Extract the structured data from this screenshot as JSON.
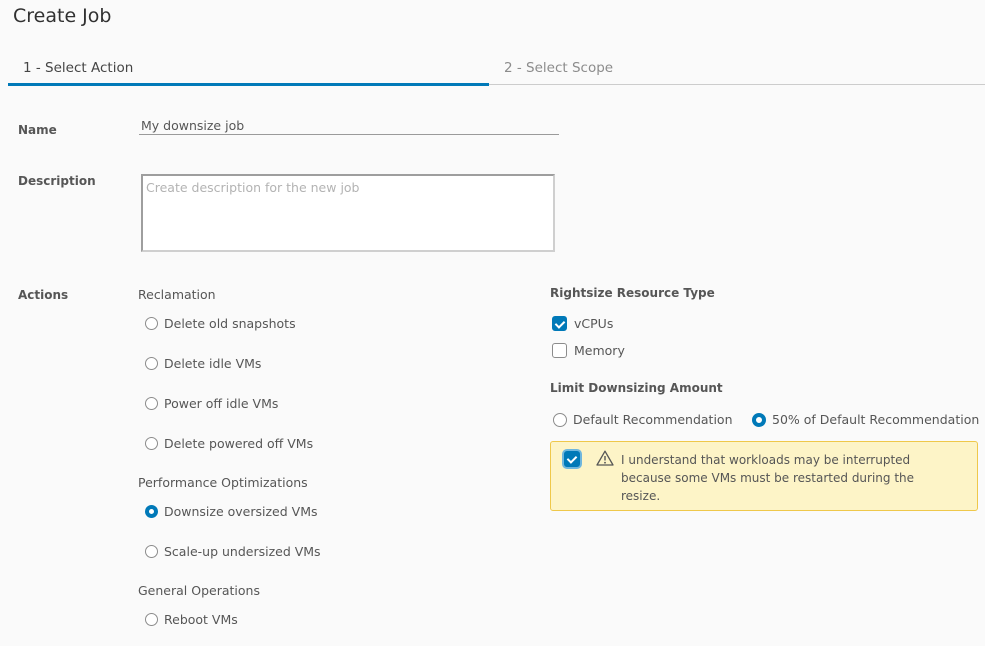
{
  "header": {
    "title": "Create Job"
  },
  "tabs": [
    {
      "label": "1 - Select Action",
      "active": true
    },
    {
      "label": "2 - Select Scope",
      "active": false
    }
  ],
  "form": {
    "name": {
      "label": "Name",
      "value": "My downsize job"
    },
    "description": {
      "label": "Description",
      "value": "",
      "placeholder": "Create description for the new job"
    },
    "actions": {
      "label": "Actions",
      "groups": [
        {
          "title": "Reclamation",
          "options": [
            {
              "label": "Delete old snapshots",
              "selected": false
            },
            {
              "label": "Delete idle VMs",
              "selected": false
            },
            {
              "label": "Power off idle VMs",
              "selected": false
            },
            {
              "label": "Delete powered off VMs",
              "selected": false
            }
          ]
        },
        {
          "title": "Performance Optimizations",
          "options": [
            {
              "label": "Downsize oversized VMs",
              "selected": true
            },
            {
              "label": "Scale-up undersized VMs",
              "selected": false
            }
          ]
        },
        {
          "title": "General Operations",
          "options": [
            {
              "label": "Reboot VMs",
              "selected": false
            }
          ]
        }
      ]
    },
    "rightsize": {
      "title": "Rightsize Resource Type",
      "options": [
        {
          "label": "vCPUs",
          "checked": true
        },
        {
          "label": "Memory",
          "checked": false
        }
      ]
    },
    "limit": {
      "title": "Limit Downsizing Amount",
      "options": [
        {
          "label": "Default Recommendation",
          "selected": false
        },
        {
          "label": "50% of Default Recommendation",
          "selected": true
        }
      ]
    },
    "warning": {
      "checked": true,
      "icon": "warning-triangle-icon",
      "text": "I understand that workloads may be interrupted because some VMs must be restarted during the resize."
    }
  },
  "colors": {
    "accent": "#0079b8",
    "warning_bg": "#fdf4c7",
    "warning_border": "#efc84a"
  }
}
